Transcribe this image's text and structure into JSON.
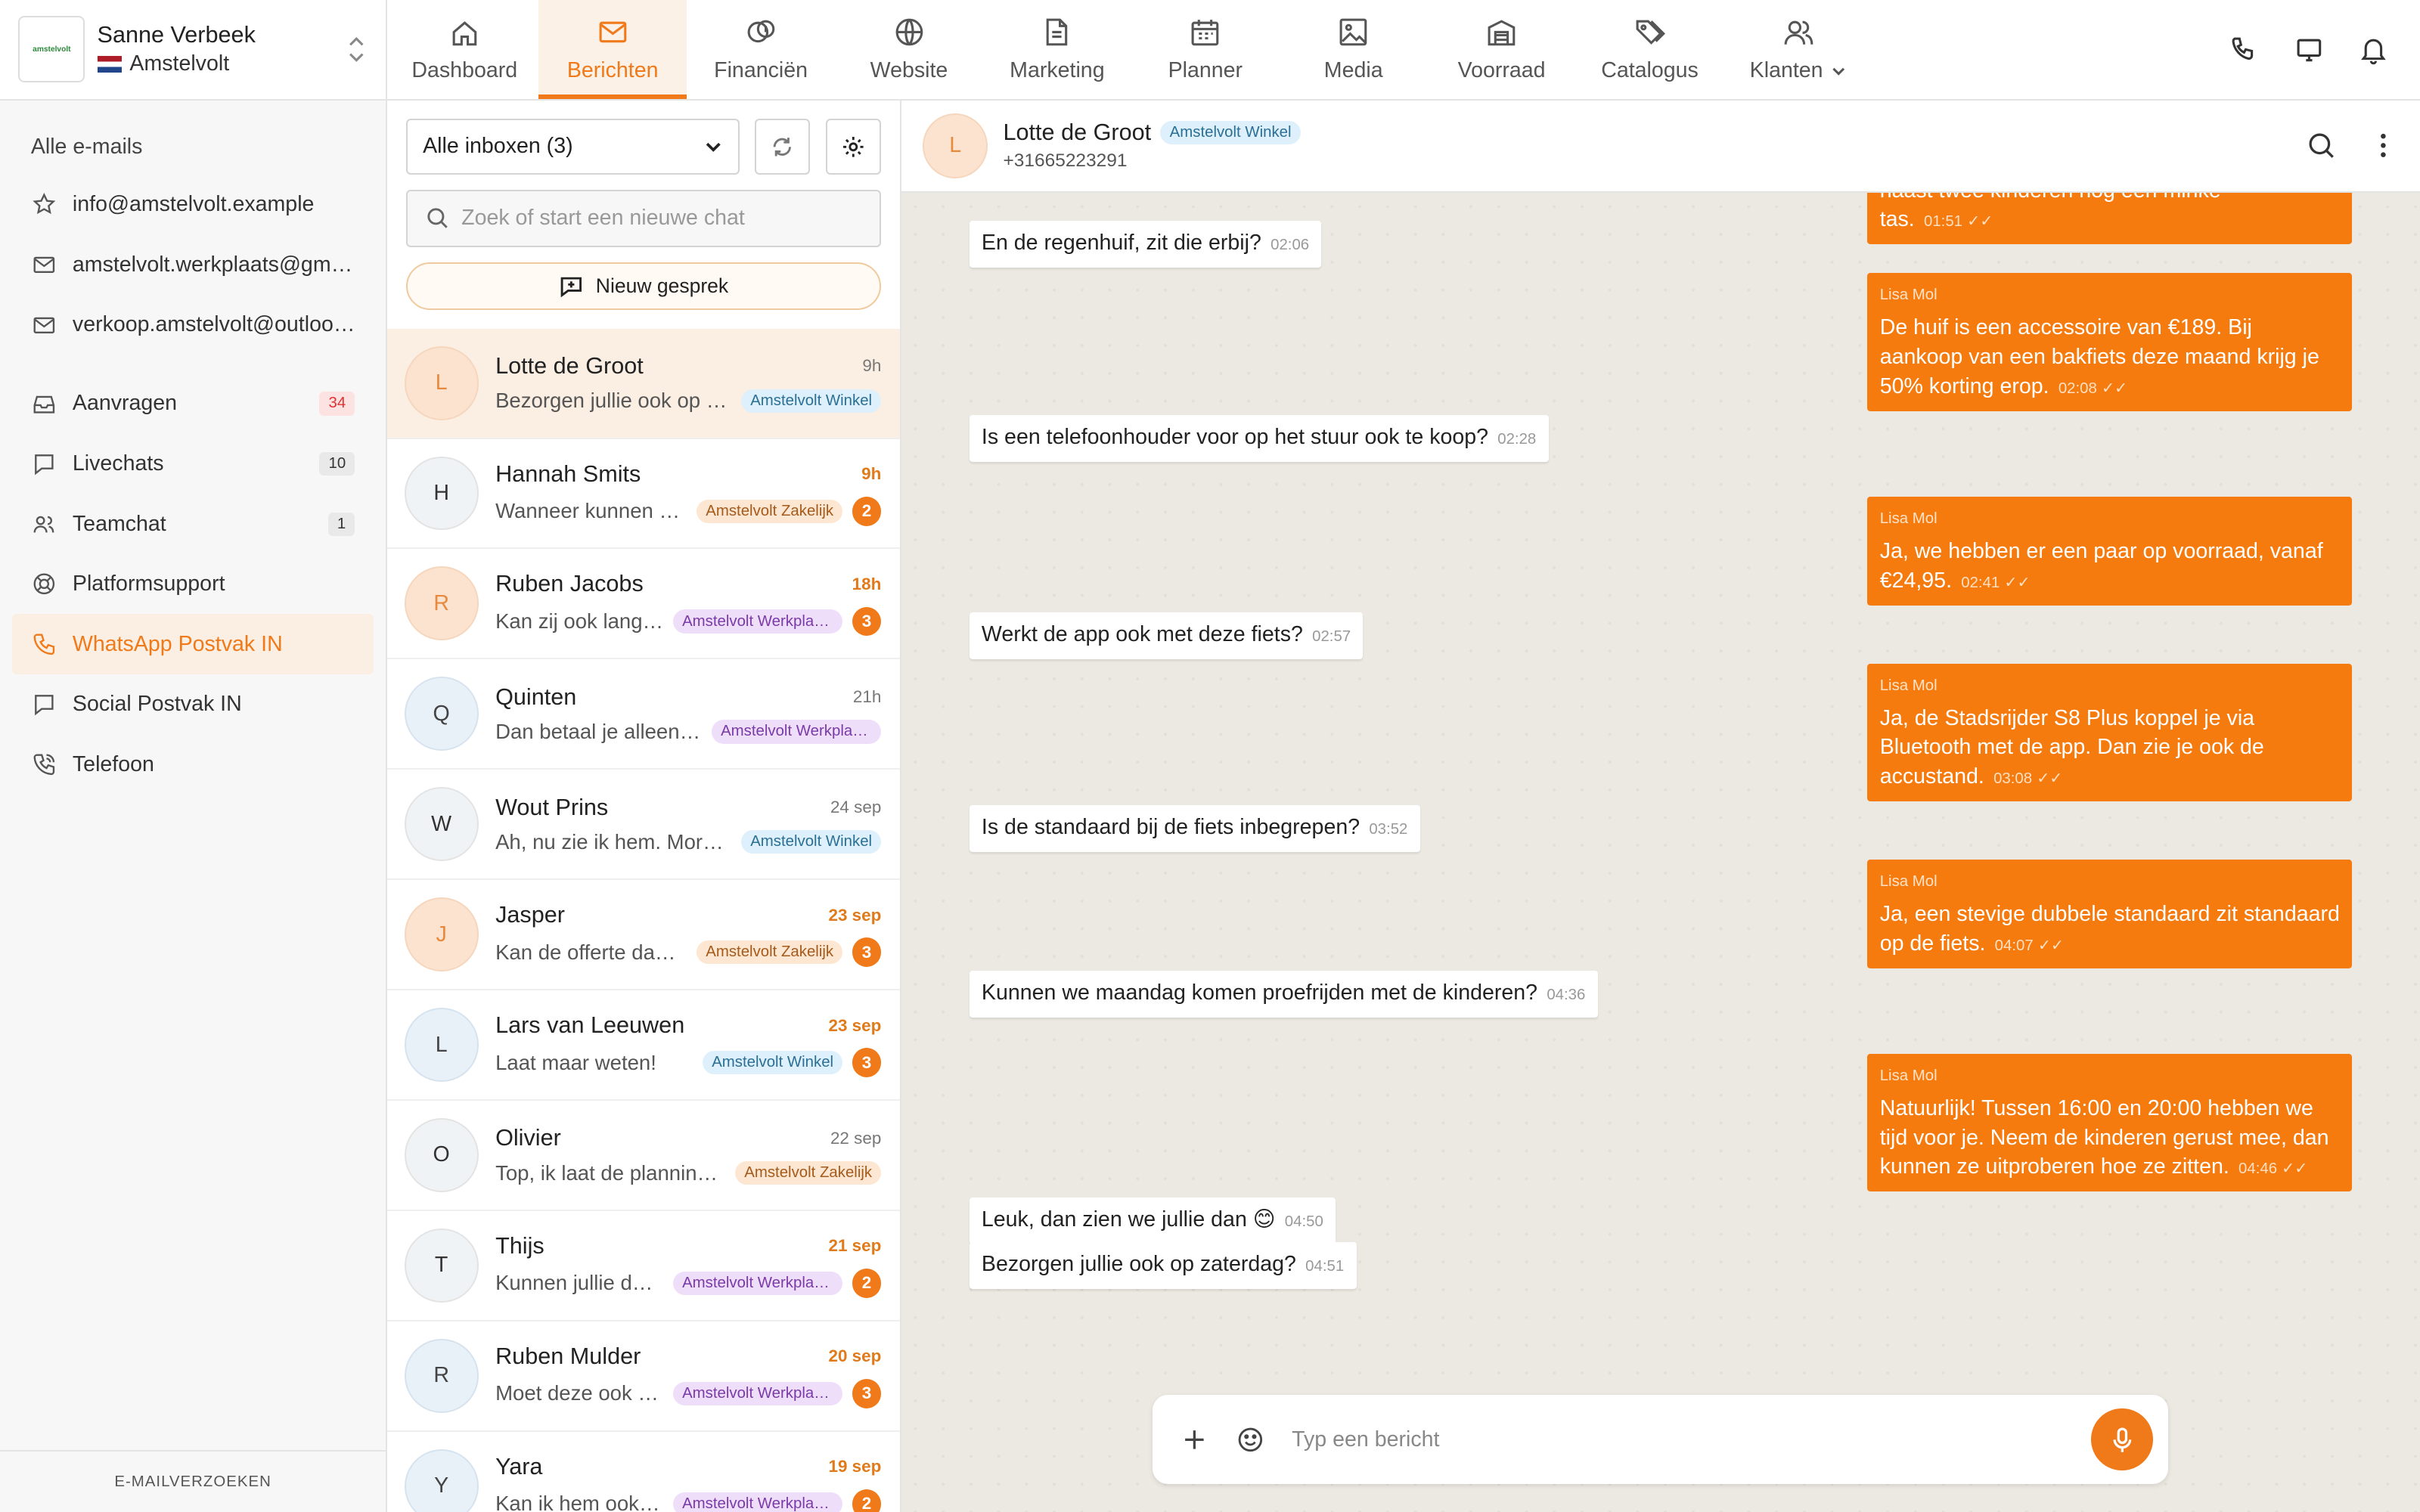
{
  "account": {
    "name": "Sanne Verbeek",
    "location": "Amstelvolt",
    "logo_text": "amstelvolt"
  },
  "nav": [
    {
      "label": "Dashboard",
      "icon": "home-icon"
    },
    {
      "label": "Berichten",
      "icon": "mail-icon",
      "active": true
    },
    {
      "label": "Financiën",
      "icon": "coins-icon"
    },
    {
      "label": "Website",
      "icon": "globe-icon"
    },
    {
      "label": "Marketing",
      "icon": "document-icon"
    },
    {
      "label": "Planner",
      "icon": "calendar-icon"
    },
    {
      "label": "Media",
      "icon": "image-icon"
    },
    {
      "label": "Voorraad",
      "icon": "warehouse-icon"
    },
    {
      "label": "Catalogus",
      "icon": "tags-icon"
    },
    {
      "label": "Klanten",
      "icon": "users-icon"
    }
  ],
  "sidebar": {
    "heading": "Alle e-mails",
    "emails": [
      {
        "label": "info@amstelvolt.example",
        "icon": "star-icon"
      },
      {
        "label": "amstelvolt.werkplaats@gmail.com",
        "icon": "mail-icon"
      },
      {
        "label": "verkoop.amstelvolt@outlook.com",
        "icon": "mail-icon"
      }
    ],
    "items": [
      {
        "label": "Aanvragen",
        "icon": "inbox-icon",
        "count": "34"
      },
      {
        "label": "Livechats",
        "icon": "chat-icon",
        "count": "10"
      },
      {
        "label": "Teamchat",
        "icon": "team-icon",
        "count": "1"
      },
      {
        "label": "Platformsupport",
        "icon": "lifebuoy-icon"
      },
      {
        "label": "WhatsApp Postvak IN",
        "icon": "phone-icon",
        "active": true
      },
      {
        "label": "Social Postvak IN",
        "icon": "chat-icon"
      },
      {
        "label": "Telefoon",
        "icon": "phone-call-icon"
      }
    ],
    "footer": "E-MAILVERZOEKEN"
  },
  "convlist": {
    "inbox_select": "Alle inboxen (3)",
    "search_placeholder": "Zoek of start een nieuwe chat",
    "new_chat": "Nieuw gesprek",
    "items": [
      {
        "initial": "L",
        "name": "Lotte de Groot",
        "time": "9h",
        "preview": "Bezorgen jullie ook op zaterdag?",
        "tag": "Amstelvolt Winkel",
        "tagType": "winkel",
        "avatar": "orange",
        "active": true
      },
      {
        "initial": "H",
        "name": "Hannah Smits",
        "time": "9h",
        "unread": true,
        "preview": "Wanneer kunnen we langskomen?",
        "tag": "Amstelvolt Zakelijk",
        "tagType": "zakelijk",
        "badge": "2",
        "avatar": "grey"
      },
      {
        "initial": "R",
        "name": "Ruben Jacobs",
        "time": "18h",
        "unread": true,
        "preview": "Kan zij ook langskomen?",
        "tag": "Amstelvolt Werkplaats",
        "tagType": "werkplaats",
        "badge": "3",
        "avatar": "orange"
      },
      {
        "initial": "Q",
        "name": "Quinten",
        "time": "21h",
        "preview": "Dan betaal je alleen €...",
        "tag": "Amstelvolt Werkplaats",
        "tagType": "werkplaats",
        "avatar": "blue"
      },
      {
        "initial": "W",
        "name": "Wout Prins",
        "time": "24 sep",
        "preview": "Ah, nu zie ik hem. Morgen kom ik",
        "tag": "Amstelvolt Winkel",
        "tagType": "winkel",
        "avatar": "grey"
      },
      {
        "initial": "J",
        "name": "Jasper",
        "time": "23 sep",
        "unread": true,
        "preview": "Kan de offerte daar naartoe?",
        "tag": "Amstelvolt Zakelijk",
        "tagType": "zakelijk",
        "badge": "3",
        "avatar": "orange"
      },
      {
        "initial": "L",
        "name": "Lars van Leeuwen",
        "time": "23 sep",
        "unread": true,
        "preview": "Laat maar weten!",
        "tag": "Amstelvolt Winkel",
        "tagType": "winkel",
        "badge": "3",
        "avatar": "blue"
      },
      {
        "initial": "O",
        "name": "Olivier",
        "time": "22 sep",
        "preview": "Top, ik laat de planning weten",
        "tag": "Amstelvolt Zakelijk",
        "tagType": "zakelijk",
        "avatar": "grey"
      },
      {
        "initial": "T",
        "name": "Thijs",
        "time": "21 sep",
        "unread": true,
        "preview": "Kunnen jullie de fiets ophalen?",
        "tag": "Amstelvolt Werkplaats",
        "tagType": "werkplaats",
        "badge": "2",
        "avatar": "grey"
      },
      {
        "initial": "R",
        "name": "Ruben Mulder",
        "time": "20 sep",
        "unread": true,
        "preview": "Moet deze ook vervangen?",
        "tag": "Amstelvolt Werkplaats",
        "tagType": "werkplaats",
        "badge": "3",
        "avatar": "blue"
      },
      {
        "initial": "Y",
        "name": "Yara",
        "time": "19 sep",
        "unread": true,
        "preview": "Kan ik hem ook ophalen?",
        "tag": "Amstelvolt Werkplaats",
        "tagType": "werkplaats",
        "badge": "2",
        "avatar": "blue"
      }
    ]
  },
  "chat": {
    "contact_initial": "L",
    "contact_name": "Lotte de Groot",
    "contact_tag": "Amstelvolt Winkel",
    "contact_phone": "+31665223291",
    "composer_placeholder": "Typ een bericht",
    "messages": [
      {
        "dir": "out",
        "sender": "",
        "text": "haast twee kinderen nog een minke tas.",
        "time": "01:51",
        "partial": true
      },
      {
        "dir": "in",
        "text": "En de regenhuif, zit die erbij?",
        "time": "02:06"
      },
      {
        "dir": "out",
        "sender": "Lisa Mol",
        "text": "De huif is een accessoire van €189. Bij aankoop van een bakfiets deze maand krijg je 50% korting erop.",
        "time": "02:08"
      },
      {
        "dir": "in",
        "text": "Is een telefoonhouder voor op het stuur ook te koop?",
        "time": "02:28"
      },
      {
        "dir": "out",
        "sender": "Lisa Mol",
        "text": "Ja, we hebben er een paar op voorraad, vanaf €24,95.",
        "time": "02:41"
      },
      {
        "dir": "in",
        "text": "Werkt de app ook met deze fiets?",
        "time": "02:57"
      },
      {
        "dir": "out",
        "sender": "Lisa Mol",
        "text": "Ja, de Stadsrijder S8 Plus koppel je via Bluetooth met de app. Dan zie je ook de accustand.",
        "time": "03:08"
      },
      {
        "dir": "in",
        "text": "Is de standaard bij de fiets inbegrepen?",
        "time": "03:52"
      },
      {
        "dir": "out",
        "sender": "Lisa Mol",
        "text": "Ja, een stevige dubbele standaard zit standaard op de fiets.",
        "time": "04:07"
      },
      {
        "dir": "in",
        "text": "Kunnen we maandag komen proefrijden met de kinderen?",
        "time": "04:36"
      },
      {
        "dir": "out",
        "sender": "Lisa Mol",
        "text": "Natuurlijk! Tussen 16:00 en 20:00 hebben we tijd voor je. Neem de kinderen gerust mee, dan kunnen ze uitproberen hoe ze zitten.",
        "time": "04:46"
      },
      {
        "dir": "in",
        "text": "Leuk, dan zien we jullie dan 😊",
        "time": "04:50"
      },
      {
        "dir": "in",
        "text": "Bezorgen jullie ook op zaterdag?",
        "time": "04:51"
      }
    ]
  },
  "colors": {
    "accent": "#f07a1a",
    "bubble_out": "#f67b0e"
  }
}
